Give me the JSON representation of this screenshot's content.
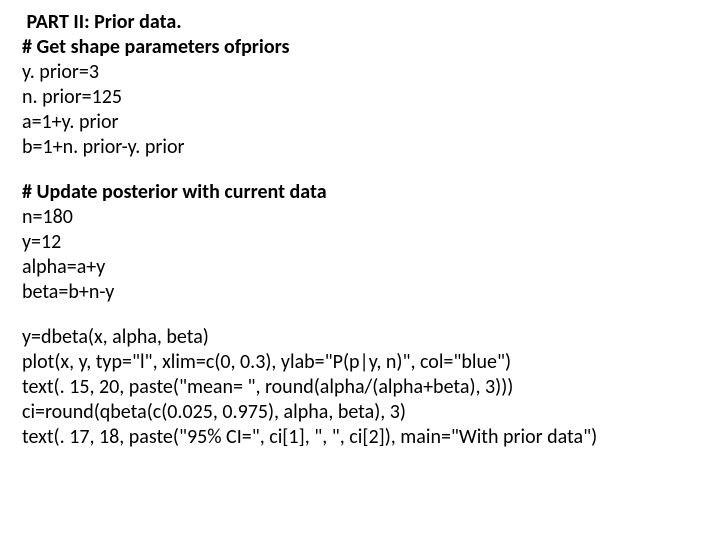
{
  "block1": {
    "title": " PART II: Prior data.",
    "heading": "# Get shape parameters ofpriors",
    "l1": "y. prior=3",
    "l2": "n. prior=125",
    "l3": "a=1+y. prior",
    "l4": "b=1+n. prior-y. prior"
  },
  "block2": {
    "heading": "# Update posterior with current data",
    "l1": "n=180",
    "l2": "y=12",
    "l3": "alpha=a+y",
    "l4": "beta=b+n-y"
  },
  "block3": {
    "l1": "y=dbeta(x, alpha, beta)",
    "l2": "plot(x, y, typ=\"l\", xlim=c(0, 0.3), ylab=\"P(p|y, n)\", col=\"blue\")",
    "l3": "text(. 15, 20, paste(\"mean= \", round(alpha/(alpha+beta), 3)))",
    "l4": "ci=round(qbeta(c(0.025, 0.975), alpha, beta), 3)",
    "l5": "text(. 17, 18, paste(\"95% CI=\", ci[1], \", \", ci[2]), main=\"With prior data\")"
  }
}
